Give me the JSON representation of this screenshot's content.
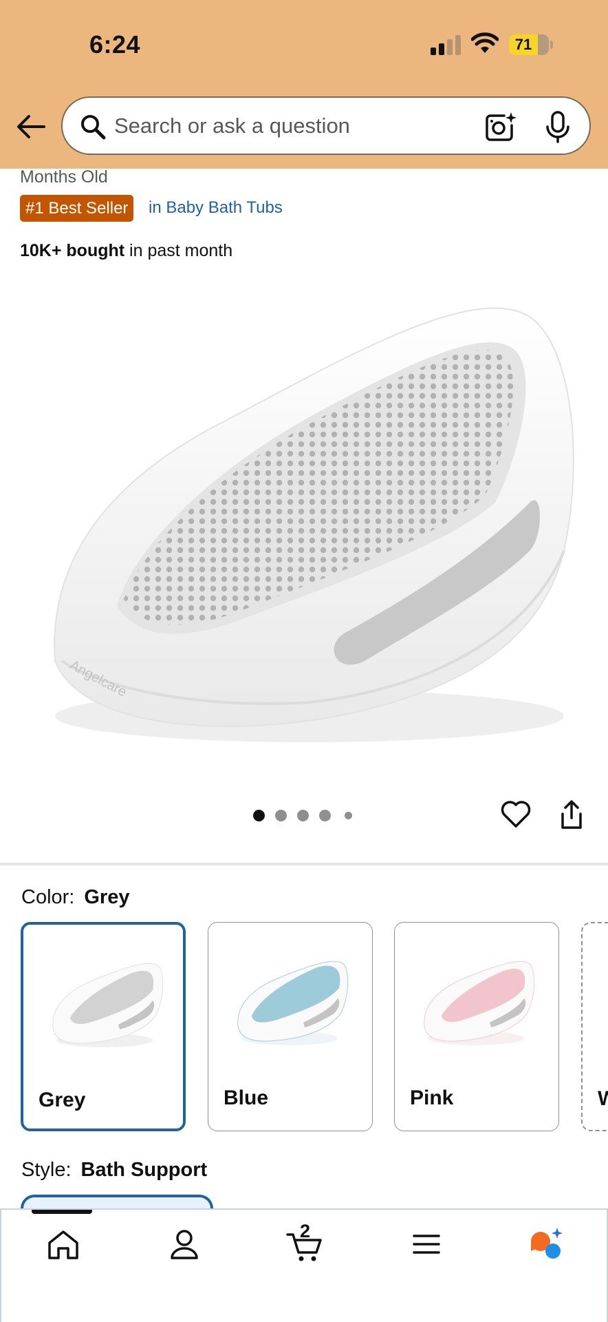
{
  "status_bar": {
    "time": "6:24",
    "battery": "71"
  },
  "search": {
    "placeholder": "Search or ask a question"
  },
  "product": {
    "age_text": "Months Old",
    "best_seller_badge": "#1 Best Seller",
    "category_link": "in Baby Bath Tubs",
    "bought_bold": "10K+ bought",
    "bought_rest": " in past month",
    "image_brand": "Angelcare"
  },
  "gallery": {
    "image_count": 5,
    "active_index": 0
  },
  "color": {
    "label": "Color:",
    "selected": "Grey",
    "options": [
      {
        "label": "Grey",
        "mesh": "#cfcfcf",
        "trim": "#d9d9d9"
      },
      {
        "label": "Blue",
        "mesh": "#9ecbd9",
        "trim": "#a8cde0"
      },
      {
        "label": "Pink",
        "mesh": "#f2c4cd",
        "trim": "#f1ccd3"
      },
      {
        "label": "W"
      }
    ]
  },
  "style": {
    "label": "Style:",
    "selected": "Bath Support"
  },
  "bottom_nav": {
    "cart_count": "2"
  },
  "colors": {
    "header": "#ecb77e",
    "badge": "#c45500",
    "link": "#2162a1",
    "selected_border": "#2162a1"
  }
}
